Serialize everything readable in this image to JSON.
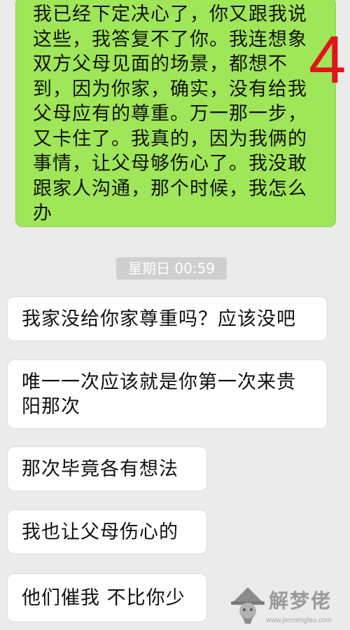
{
  "sent_message": {
    "text": "我已经下定决心了，你又跟我说这些，我答复不了你。我连想象双方父母见面的场景，都想不到，因为你家，确实，没有给我父母应有的尊重。万一那一步，又卡住了。我真的，因为我俩的事情，让父母够伤心了。我没敢跟家人沟通，那个时候，我怎么办",
    "corner_number": "4"
  },
  "timestamp": "星期日 00:59",
  "received_messages": [
    "我家没给你家尊重吗？应该没吧",
    "唯一一次应该就是你第一次来贵阳那次",
    "那次毕竟各有想法",
    "我也让父母伤心的",
    "他们催我 不比你少"
  ],
  "watermark": {
    "title": "解梦佬",
    "url": "www.jiemenglao.com"
  },
  "colors": {
    "background": "#ebebeb",
    "sent_bubble": "#9fe658",
    "received_bubble": "#ffffff",
    "timestamp_bg": "#cfcfcf",
    "corner_number": "#e0141a"
  }
}
